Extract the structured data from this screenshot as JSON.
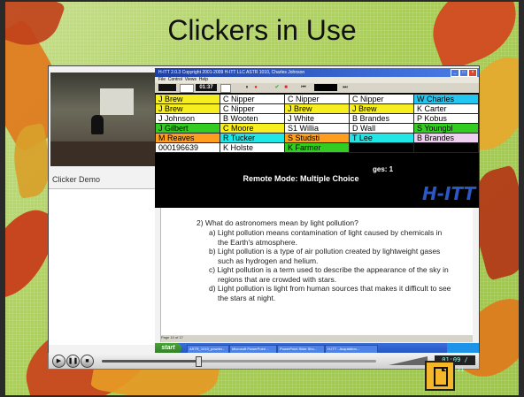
{
  "slide": {
    "title": "Clickers in Use",
    "colors": {
      "background": "#a9cf52",
      "icon_fill": "#f5b62a"
    }
  },
  "video_panel": {
    "label": "Clicker Demo"
  },
  "app": {
    "title": "H-ITT 2.0.3 Copyright 2001-2009 H-ITT LLC ASTR 1010, Charles Johnson",
    "menu": [
      "File",
      "Control",
      "Views",
      "Help"
    ],
    "toolbar": {
      "timer": "01:37"
    },
    "roster": [
      [
        "J Brew",
        "C Nipper",
        "C Nipper",
        "C Nipper",
        "W Charles"
      ],
      [
        "J Brew",
        "C Nipper",
        "J Brew",
        "J Brew",
        "K Carter"
      ],
      [
        "J Johnson",
        "B Wooten",
        "J White",
        "B Brandes",
        "P Kobus"
      ],
      [
        "J Gilbert",
        "C Moore",
        "S1 Willia",
        "D Wall",
        "S Youngbl"
      ],
      [
        "M Reaves",
        "R Tucker",
        "S Studsti",
        "T Lee",
        "B Brandes"
      ],
      [
        "000196639",
        "K Holste",
        "K Farmer",
        "",
        ""
      ]
    ],
    "roster_colors": [
      [
        "#f6ee1e",
        "#ffffff",
        "#ffffff",
        "#ffffff",
        "#21c7f1"
      ],
      [
        "#f6ee1e",
        "#ffffff",
        "#f6ee1e",
        "#f6ee1e",
        "#ffffff"
      ],
      [
        "#ffffff",
        "#ffffff",
        "#ffffff",
        "#ffffff",
        "#ffffff"
      ],
      [
        "#33cc22",
        "#f6ee1e",
        "#ffffff",
        "#ffffff",
        "#33cc22"
      ],
      [
        "#ff9d1e",
        "#21e6e6",
        "#ff9d1e",
        "#21e6e6",
        "#f0d0f0"
      ],
      [
        "#ffffff",
        "#ffffff",
        "#33cc22",
        "#000000",
        "#000000"
      ]
    ],
    "responses_label": "ges: 1",
    "mode_label": "Remote Mode: Multiple Choice",
    "logo_text": "H-ITT"
  },
  "document": {
    "question": "2) What do astronomers mean by light pollution?",
    "answers": [
      "a) Light pollution means contamination of light caused by chemicals in",
      "the Earth's atmosphere.",
      "b) Light pollution is a type of air pollution created by lightweight gases",
      "such as hydrogen and helium.",
      "c) Light pollution is a term used to describe the appearance of the sky in",
      "regions that are crowded with stars.",
      "d) Light pollution is light from human sources that makes it difficult to see",
      "the stars at night."
    ],
    "status": "Page 10 of 17"
  },
  "taskbar": {
    "start": "start",
    "tasks": [
      "ASTR_1010_powder...",
      "Microsoft PowerPoint ...",
      "PowerPoint Slide Sho...",
      "H-ITT - Acquisition..."
    ]
  },
  "player": {
    "time": "01:09 / 03:21",
    "progress": 0.35
  }
}
